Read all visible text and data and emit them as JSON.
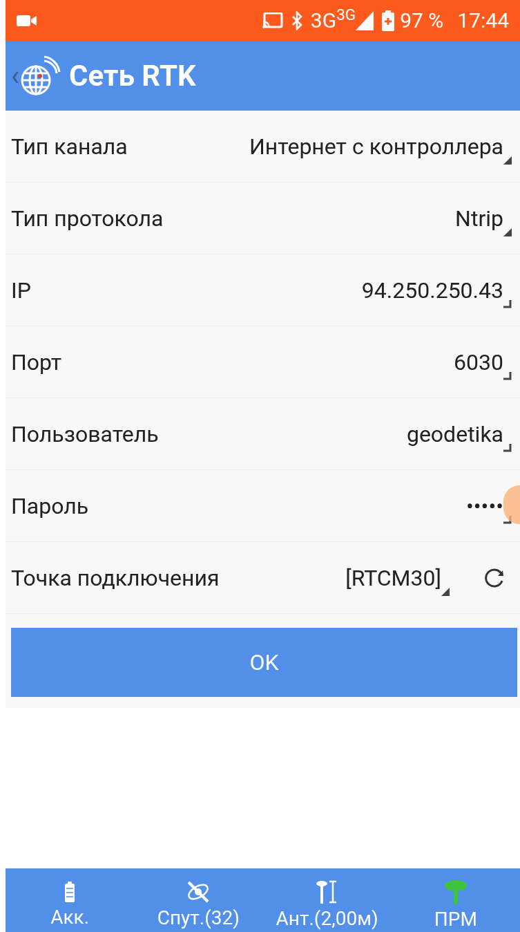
{
  "status_bar": {
    "network": "3G$^{3G}$",
    "battery": "97 %",
    "time": "17:44"
  },
  "header": {
    "back": "‹",
    "title": "Сеть RTK"
  },
  "fields": [
    {
      "label": "Тип канала",
      "value": "Интернет с контроллера",
      "kind": "dropdown"
    },
    {
      "label": "Тип протокола",
      "value": "Ntrip",
      "kind": "dropdown"
    },
    {
      "label": "IP",
      "value": "94.250.250.43",
      "kind": "input"
    },
    {
      "label": "Порт",
      "value": "6030",
      "kind": "input"
    },
    {
      "label": "Пользователь",
      "value": "geodetika",
      "kind": "input"
    },
    {
      "label": "Пароль",
      "value": "•••••",
      "kind": "input"
    },
    {
      "label": "Точка подключения",
      "value": "[RTCM30]",
      "kind": "dropdown_refresh"
    }
  ],
  "ok_button": "OK",
  "bottom_bar": [
    {
      "label": "Акк.",
      "kind": "battery"
    },
    {
      "label": "Спут.(32)",
      "kind": "satellite"
    },
    {
      "label": "Ант.(2,00м)",
      "kind": "antenna"
    },
    {
      "label": "ПРМ",
      "kind": "receiver"
    }
  ]
}
